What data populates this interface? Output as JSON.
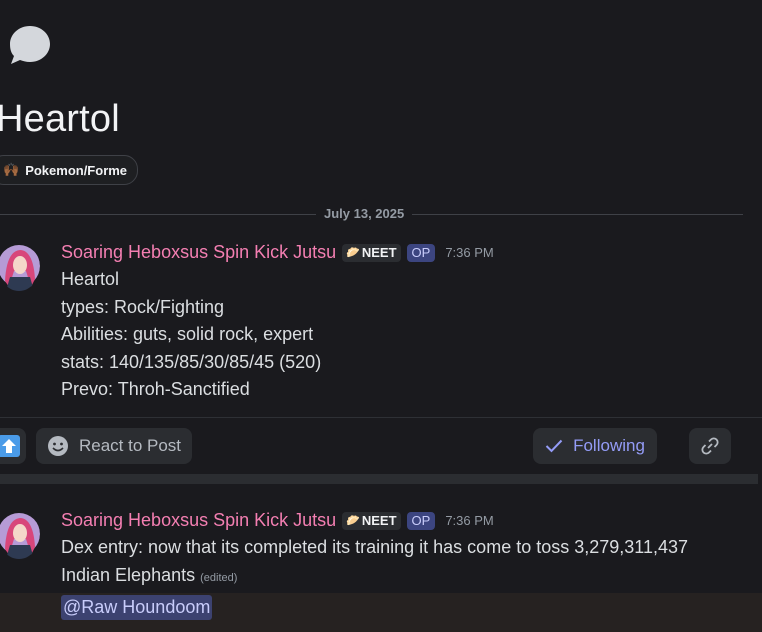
{
  "thread": {
    "icon": "chat-bubble-icon",
    "title": "Heartol",
    "tag": {
      "emoji": "🙌🏾",
      "label": "Pokemon/Forme"
    }
  },
  "divider": {
    "date": "July 13, 2025"
  },
  "messages": [
    {
      "author": "Soaring Heboxsus Spin Kick Jutsu",
      "role": "NEET",
      "role_icon": "🥟",
      "op": "OP",
      "time": "7:36 PM",
      "lines": [
        "Heartol",
        "types: Rock/Fighting",
        "Abilities: guts, solid rock, expert",
        "stats: 140/135/85/30/85/45 (520)",
        "Prevo: Throh-Sanctified"
      ]
    },
    {
      "author": "Soaring Heboxsus Spin Kick Jutsu",
      "role": "NEET",
      "role_icon": "🥟",
      "op": "OP",
      "time": "7:36 PM",
      "lines": [
        "Dex entry: now that its completed its training it has come to toss 3,279,311,437",
        "Indian Elephants"
      ],
      "edited": "(edited)",
      "mention": "@Raw Houndoom"
    }
  ],
  "actions": {
    "react_label": "React to Post",
    "follow_label": "Following"
  },
  "colors": {
    "background": "#1a1a1e",
    "username": "#f47fb2",
    "accent": "#949cf7",
    "mention_bg": "#3c4270"
  }
}
